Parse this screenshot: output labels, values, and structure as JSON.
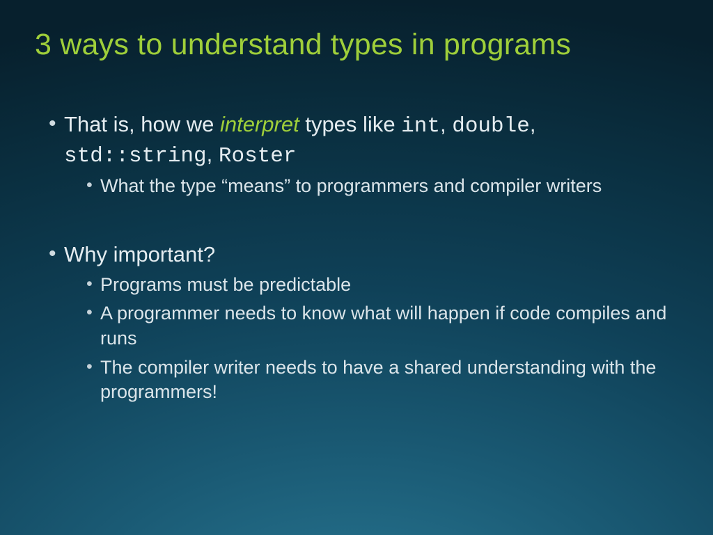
{
  "title": "3 ways to understand types in programs",
  "b1": {
    "pre": "That is, how we ",
    "accent": "interpret",
    "mid": " types like ",
    "t1": "int",
    "c1": ", ",
    "t2": "double",
    "c2": ", ",
    "t3": "std::string",
    "c3": ", ",
    "t4": "Roster",
    "sub1": "What the type “means” to programmers and compiler writers"
  },
  "b2": {
    "text": "Why important?",
    "sub1": "Programs must be predictable",
    "sub2": "A programmer needs to know what will happen if code compiles and runs",
    "sub3": "The compiler writer needs to have a shared understanding with the programmers!"
  }
}
